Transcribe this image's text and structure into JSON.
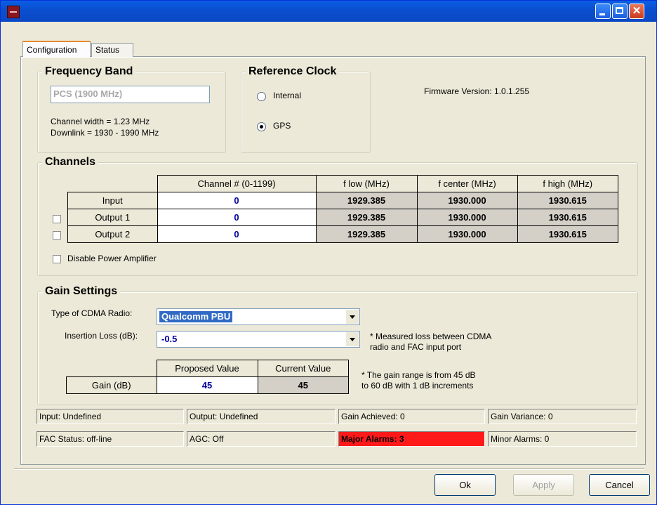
{
  "window": {
    "icon": "app-icon",
    "controls": [
      "minimize-icon",
      "maximize-icon",
      "close-icon"
    ]
  },
  "tabs": [
    {
      "label": "Configuration",
      "active": true
    },
    {
      "label": "Status",
      "active": false
    }
  ],
  "frequency_band": {
    "title": "Frequency Band",
    "value": "PCS (1900 MHz)",
    "channel_width": "Channel width = 1.23 MHz",
    "downlink": "Downlink = 1930 - 1990 MHz"
  },
  "reference_clock": {
    "title": "Reference Clock",
    "options": [
      {
        "label": "Internal",
        "selected": false
      },
      {
        "label": "GPS",
        "selected": true
      }
    ]
  },
  "firmware": "Firmware Version: 1.0.1.255",
  "channels": {
    "title": "Channels",
    "headers": [
      "Channel # (0-1199)",
      "f low (MHz)",
      "f center (MHz)",
      "f high (MHz)"
    ],
    "rows": [
      {
        "label": "Input",
        "channel": "0",
        "f_low": "1929.385",
        "f_center": "1930.000",
        "f_high": "1930.615"
      },
      {
        "label": "Output 1",
        "channel": "0",
        "f_low": "1929.385",
        "f_center": "1930.000",
        "f_high": "1930.615"
      },
      {
        "label": "Output 2",
        "channel": "0",
        "f_low": "1929.385",
        "f_center": "1930.000",
        "f_high": "1930.615"
      }
    ],
    "disable_pa_label": "Disable Power Amplifier"
  },
  "gain_settings": {
    "title": "Gain Settings",
    "radio_type_label": "Type of CDMA Radio:",
    "radio_type_value": "Qualcomm PBU",
    "insertion_loss_label": "Insertion Loss (dB):",
    "insertion_loss_value": "-0.5",
    "note_loss_1": "* Measured loss between CDMA",
    "note_loss_2": "radio and FAC input port",
    "proposed_header": "Proposed Value",
    "current_header": "Current Value",
    "gain_label": "Gain (dB)",
    "proposed_value": "45",
    "current_value": "45",
    "note_range_1": "* The gain range is from 45 dB",
    "note_range_2": "to 60 dB with 1 dB increments"
  },
  "status_bar": {
    "row1": [
      "Input:  Undefined",
      "Output:  Undefined",
      "Gain Achieved: 0",
      "Gain Variance: 0"
    ],
    "row2": [
      "FAC Status: off-line",
      "AGC: Off",
      "Major Alarms: 3",
      "Minor Alarms: 0"
    ],
    "alarm_color": "#ff1a1a"
  },
  "buttons": {
    "ok": "Ok",
    "apply": "Apply",
    "cancel": "Cancel"
  }
}
